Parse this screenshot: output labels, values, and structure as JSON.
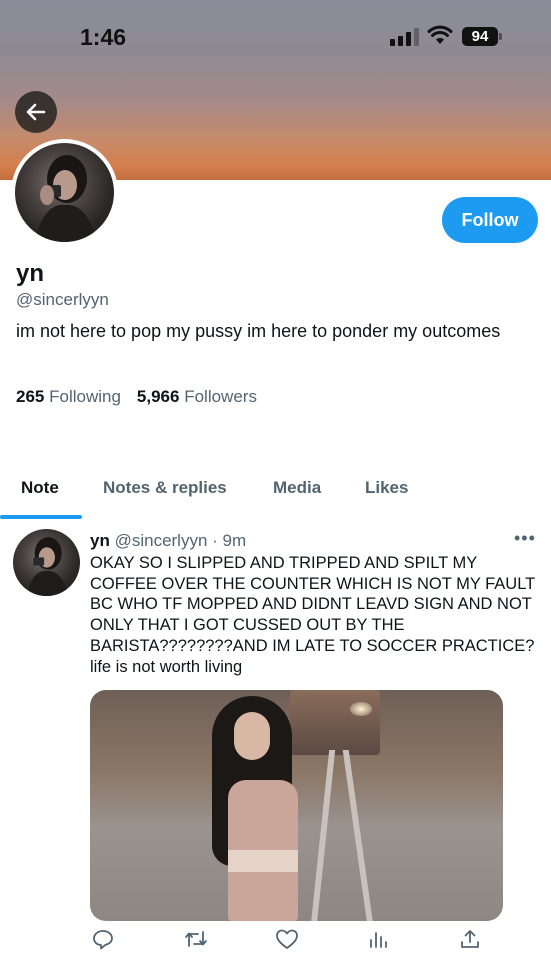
{
  "status_bar": {
    "time": "1:46",
    "battery": "94"
  },
  "profile": {
    "name": "yn",
    "handle": "@sincerlyyn",
    "bio": "im not here to pop my pussy im here to ponder my outcomes",
    "follow_label": "Follow",
    "following_count": "265",
    "following_label": "Following",
    "followers_count": "5,966",
    "followers_label": "Followers"
  },
  "tabs": [
    {
      "label": "Note",
      "active": true
    },
    {
      "label": "Notes & replies",
      "active": false
    },
    {
      "label": "Media",
      "active": false
    },
    {
      "label": "Likes",
      "active": false
    }
  ],
  "post": {
    "name": "yn",
    "meta": "@sincerlyyn · 9m",
    "more": "•••",
    "text": "OKAY SO I SLIPPED AND TRIPPED AND SPILT MY COFFEE OVER THE COUNTER WHICH IS NOT MY FAULT BC WHO TF MOPPED AND DIDNT LEAVD SIGN AND NOT ONLY THAT I GOT CUSSED OUT BY THE BARISTA????????AND IM LATE TO SOCCER PRACTICE? life is not worth living"
  },
  "icons": {
    "back": "arrow-left-icon",
    "reply": "reply-icon",
    "retweet": "retweet-icon",
    "like": "heart-icon",
    "views": "bar-chart-icon",
    "share": "share-icon"
  },
  "colors": {
    "accent": "#1d9bf0",
    "text": "#0f1419",
    "muted": "#536471"
  }
}
